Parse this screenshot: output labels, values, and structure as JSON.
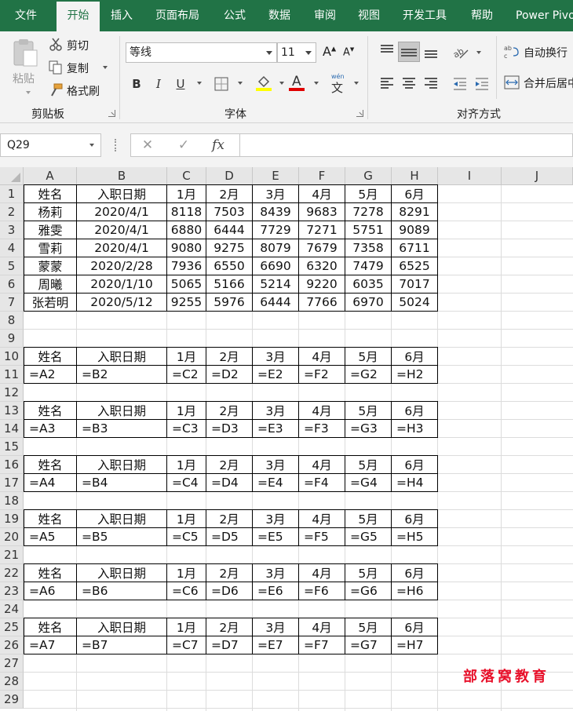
{
  "ribbon": {
    "tabs": [
      "文件",
      "开始",
      "插入",
      "页面布局",
      "公式",
      "数据",
      "审阅",
      "视图",
      "开发工具",
      "帮助",
      "Power Pivot"
    ],
    "clipboard": {
      "paste": "粘贴",
      "cut": "剪切",
      "copy": "复制",
      "format_painter": "格式刷",
      "group": "剪贴板"
    },
    "font": {
      "name": "等线",
      "size": "11",
      "bold": "B",
      "italic": "I",
      "underline": "U",
      "font_color": "A",
      "wen": "wén",
      "wen_char": "文",
      "inc": "A",
      "dec": "A",
      "group": "字体"
    },
    "alignment": {
      "wrap": "自动换行",
      "merge": "合并后居中",
      "group": "对齐方式"
    },
    "colors": {
      "tab_bg": "#217346",
      "fill_color": "#ffff00",
      "font_color": "#ff0000"
    }
  },
  "formula_bar": {
    "name_box": "Q29",
    "formula": ""
  },
  "grid": {
    "columns": [
      "A",
      "B",
      "C",
      "D",
      "E",
      "F",
      "G",
      "H",
      "I",
      "J"
    ],
    "rows": [
      "1",
      "2",
      "3",
      "4",
      "5",
      "6",
      "7",
      "8",
      "9",
      "10",
      "11",
      "12",
      "13",
      "14",
      "15",
      "16",
      "17",
      "18",
      "19",
      "20",
      "21",
      "22",
      "23",
      "24",
      "25",
      "26",
      "27",
      "28",
      "29"
    ],
    "data_table": [
      [
        "姓名",
        "入职日期",
        "1月",
        "2月",
        "3月",
        "4月",
        "5月",
        "6月"
      ],
      [
        "杨莉",
        "2020/4/1",
        "8118",
        "7503",
        "8439",
        "9683",
        "7278",
        "8291"
      ],
      [
        "雅雯",
        "2020/4/1",
        "6880",
        "6444",
        "7729",
        "7271",
        "5751",
        "9089"
      ],
      [
        "雪莉",
        "2020/4/1",
        "9080",
        "9275",
        "8079",
        "7679",
        "7358",
        "6711"
      ],
      [
        "蒙蒙",
        "2020/2/28",
        "7936",
        "6550",
        "6690",
        "6320",
        "7479",
        "6525"
      ],
      [
        "周曦",
        "2020/1/10",
        "5065",
        "5166",
        "5214",
        "9220",
        "6035",
        "7017"
      ],
      [
        "张若明",
        "2020/5/12",
        "9255",
        "5976",
        "6444",
        "7766",
        "6970",
        "5024"
      ]
    ],
    "slip_header": [
      "姓名",
      "入职日期",
      "1月",
      "2月",
      "3月",
      "4月",
      "5月",
      "6月"
    ],
    "slips": [
      [
        "=A2",
        "=B2",
        "=C2",
        "=D2",
        "=E2",
        "=F2",
        "=G2",
        "=H2"
      ],
      [
        "=A3",
        "=B3",
        "=C3",
        "=D3",
        "=E3",
        "=F3",
        "=G3",
        "=H3"
      ],
      [
        "=A4",
        "=B4",
        "=C4",
        "=D4",
        "=E4",
        "=F4",
        "=G4",
        "=H4"
      ],
      [
        "=A5",
        "=B5",
        "=C5",
        "=D5",
        "=E5",
        "=F5",
        "=G5",
        "=H5"
      ],
      [
        "=A6",
        "=B6",
        "=C6",
        "=D6",
        "=E6",
        "=F6",
        "=G6",
        "=H6"
      ],
      [
        "=A7",
        "=B7",
        "=C7",
        "=D7",
        "=E7",
        "=F7",
        "=G7",
        "=H7"
      ]
    ]
  },
  "watermark": "部落窝教育"
}
